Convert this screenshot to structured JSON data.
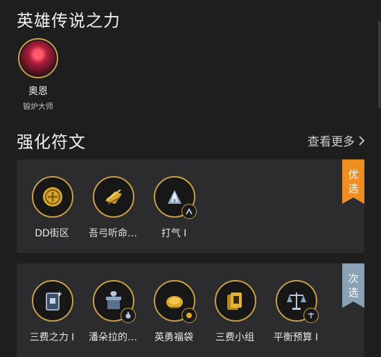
{
  "header": {
    "title": "英雄传说之力"
  },
  "champion": {
    "name": "奥恩",
    "subtitle": "锻炉大师",
    "icon": "champion-portrait"
  },
  "runes_section": {
    "title": "强化符文",
    "more_label": "查看更多"
  },
  "primary_card": {
    "badge": [
      "优",
      "选"
    ],
    "badge_color": "#ef8e22",
    "runes": [
      {
        "label": "DD街区",
        "icon": "coin-icon"
      },
      {
        "label": "吾弓听命…",
        "icon": "bow-icon"
      },
      {
        "label": "打气 I",
        "icon": "pump-icon",
        "mini_icon": "upgrade-icon"
      }
    ]
  },
  "secondary_card": {
    "badge": [
      "次",
      "选"
    ],
    "badge_color": "#8aa2b5",
    "runes": [
      {
        "label": "三费之力 I",
        "icon": "card-plus-icon"
      },
      {
        "label": "潘朵拉的…",
        "icon": "gift-box-icon",
        "mini_icon": "potion-icon"
      },
      {
        "label": "英勇福袋",
        "icon": "coin-bag-icon",
        "mini_icon": "coin-icon"
      },
      {
        "label": "三费小组",
        "icon": "card-stack-icon"
      },
      {
        "label": "平衡预算 I",
        "icon": "scale-icon",
        "mini_icon": "scale-icon"
      }
    ]
  },
  "colors": {
    "accent_gold": "#c8a046",
    "background": "#1e1e1f",
    "card": "#2c2c2e"
  }
}
